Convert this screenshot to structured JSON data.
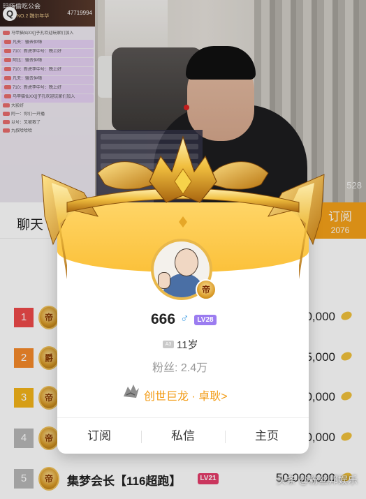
{
  "stream": {
    "room_title": "玛嗨偷吃公会",
    "rank_label": "NO.2 魏尔年华",
    "room_count": "47719994",
    "viewer_count": "528",
    "overlay_icon": "Q"
  },
  "chat_overlay": {
    "lines": [
      "马甲猫仙XX[]子孔欢迎玩家们加入",
      "凡夫：骚去仲嗨",
      "710：新虎李中号：晚上好",
      "阿比：骚去仲嗨",
      "710：新虎李中号：晚上好",
      "凡夫：骚去仲嗨",
      "710：新虎李中号：晚上好",
      "马甲猫仙XX[]子孔欢迎玩家们加入",
      "大影好",
      "阿一：你们一开播",
      "以号：又被救了",
      "九叔哈哈哈"
    ]
  },
  "tabs": {
    "chat": "聊天",
    "subscribe": "订阅",
    "subscribe_count": "2076"
  },
  "ranking": [
    {
      "rank": "1",
      "name": "",
      "level": "",
      "value": "0,000",
      "color": "#ef4a4a",
      "emblem": "帝"
    },
    {
      "rank": "2",
      "name": "",
      "level": "",
      "value": "5,000",
      "color": "#f68a2b",
      "emblem": "爵"
    },
    {
      "rank": "3",
      "name": "",
      "level": "",
      "value": "0,000",
      "color": "#f4b41a",
      "emblem": "帝"
    },
    {
      "rank": "4",
      "name": "",
      "level": "",
      "value": "0,000",
      "color": "#b8b8b8",
      "emblem": "帝"
    },
    {
      "rank": "5",
      "name": "集梦会长【116超跑】",
      "level": "LV21",
      "value": "50,000,000",
      "color": "#b8b8b8",
      "emblem": "帝"
    }
  ],
  "profile": {
    "username": "666",
    "gender_symbol": "♂",
    "level": "LV28",
    "age_badge": "A3",
    "age": "11岁",
    "fans": "粉丝: 2.4万",
    "guild": "创世巨龙 · 卓耿>",
    "avatar_badge": "帝",
    "actions": [
      "订阅",
      "私信",
      "主页"
    ]
  },
  "watermark": "头条 @粉丝邦娱乐",
  "colors": {
    "accent_orange": "#f6a21a",
    "guild_text": "#f29a12",
    "level_purple": "#9b7cf0",
    "gender_blue": "#4aa3e6"
  }
}
